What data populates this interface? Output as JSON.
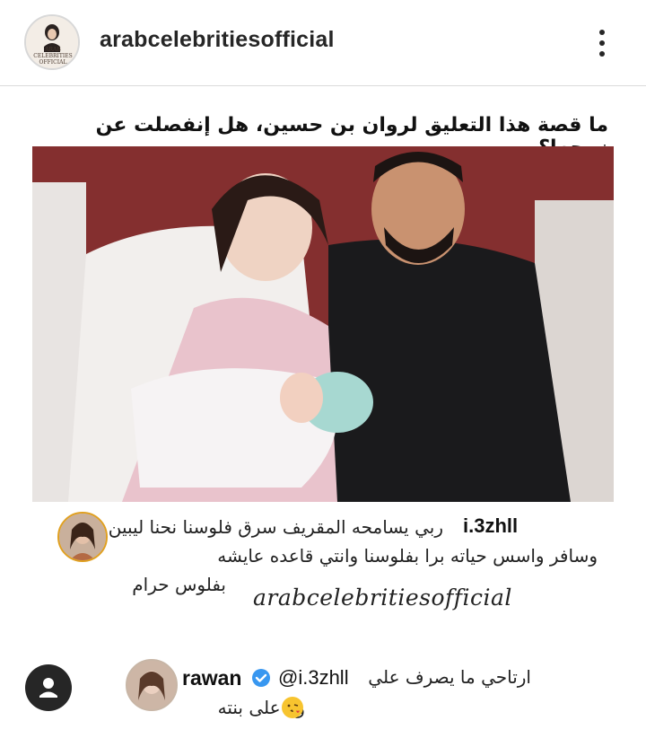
{
  "header": {
    "username": "arabcelebritiesofficial",
    "avatar_text": [
      "ARAB",
      "CELEBRITIES",
      "OFFICIAL"
    ],
    "more_icon": "more-vertical-icon"
  },
  "post": {
    "headline": "ما قصة هذا التعليق لروان بن حسين، هل إنفصلت عن زوجها؟",
    "comment": {
      "username": "i.3zhll",
      "lines": [
        "ربي يسامحه المقريف سرق فلوسنا نحنا ليبين",
        "وسافر واسس حياته برا بفلوسنا وانتي قاعده عايشه",
        "بفلوس حرام"
      ]
    },
    "watermark": "arabcelebritiesofficial",
    "reply": {
      "username": "rawan",
      "mention": "@i.3zhll",
      "line1": "ارتاحي ما يصرف علي",
      "line2": "ولا على بنته"
    }
  },
  "colors": {
    "accent_verified": "#3897f0",
    "story_ring": "#e0a020",
    "text": "#262626",
    "divider": "#dbdbdb"
  }
}
